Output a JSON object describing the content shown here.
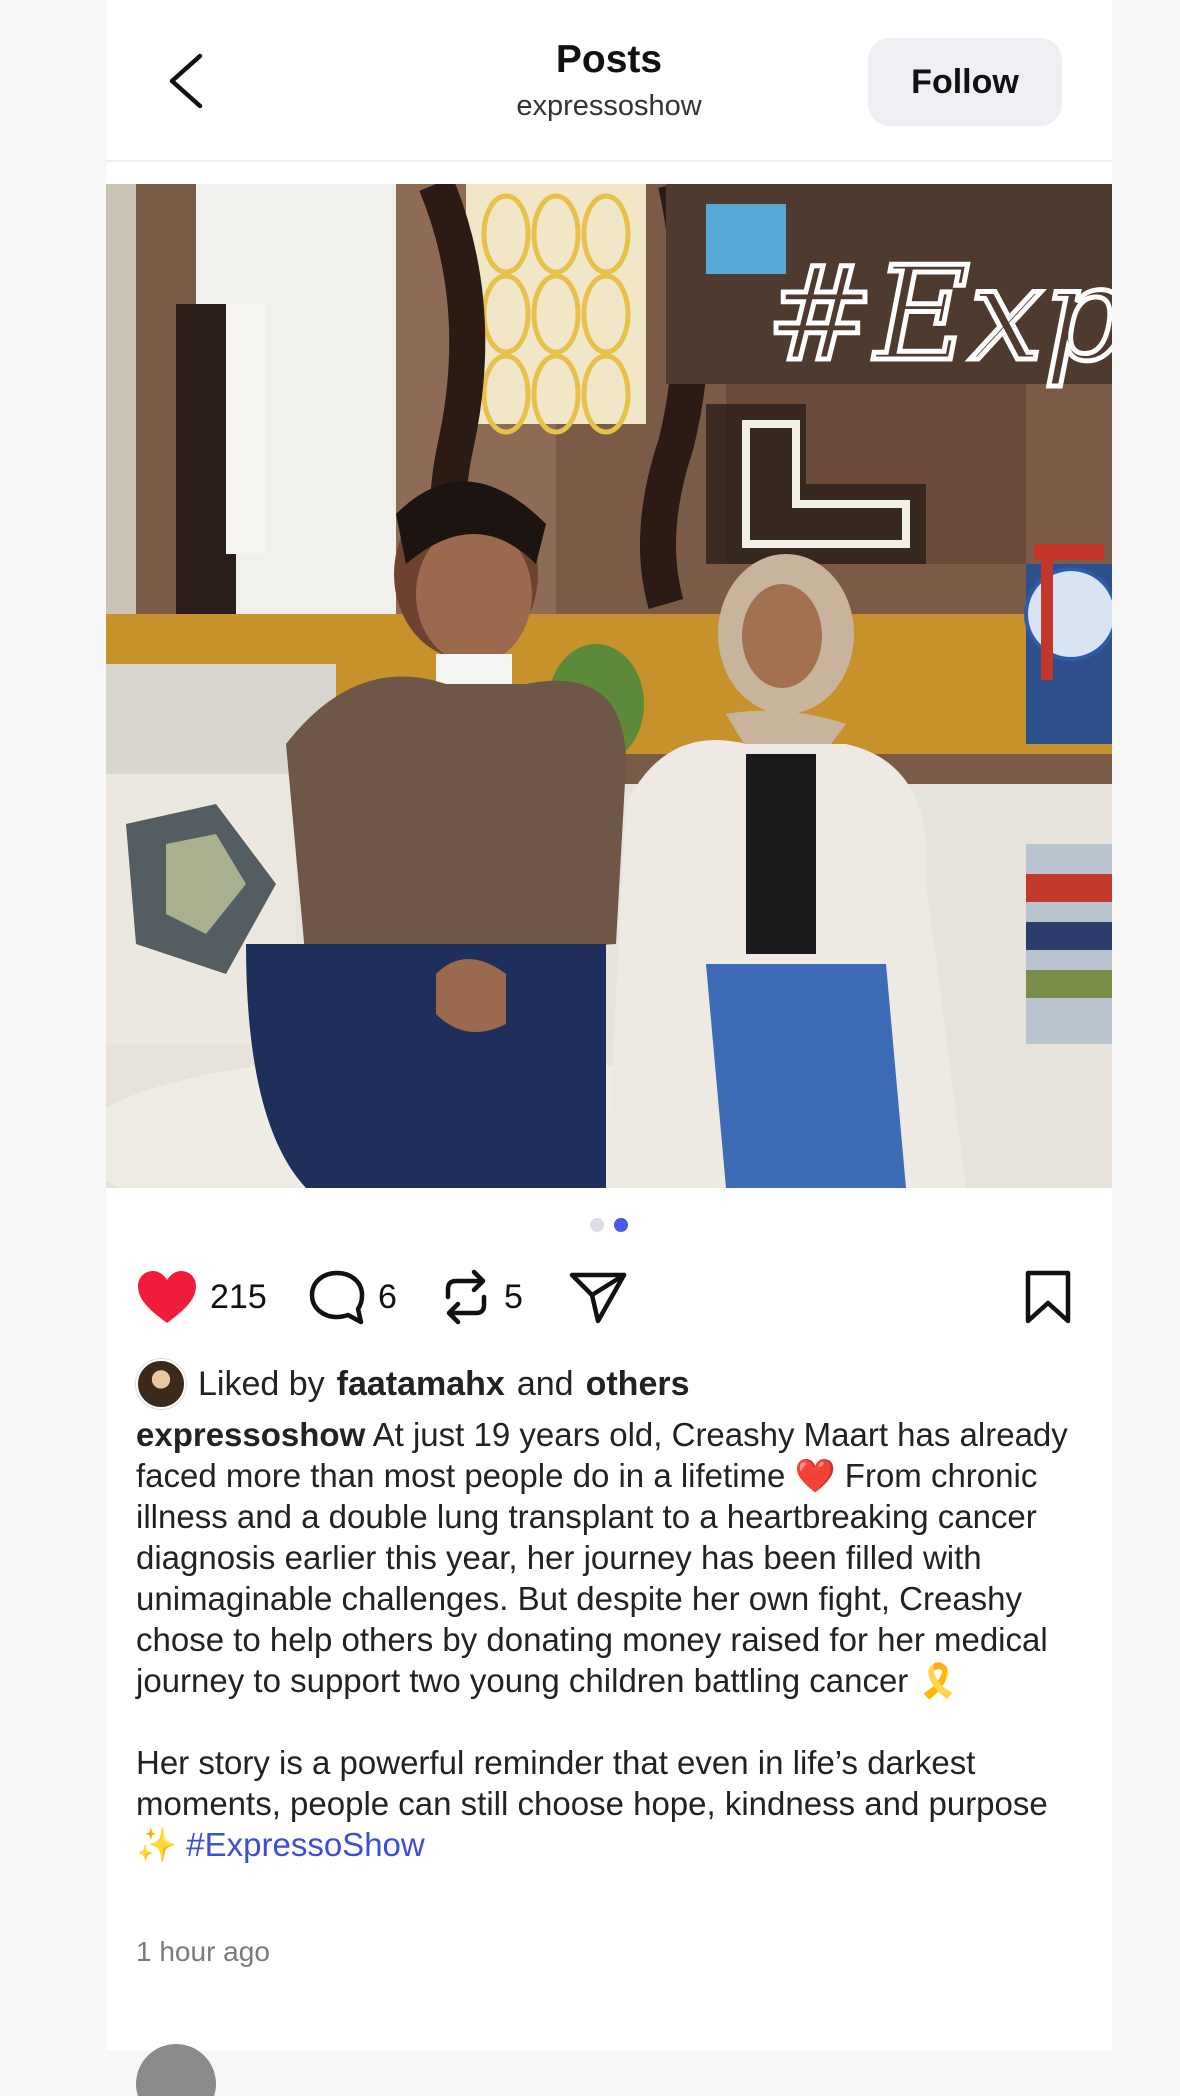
{
  "header": {
    "title": "Posts",
    "username": "expressoshow",
    "follow_label": "Follow"
  },
  "post": {
    "image_neon_text": "#Expr",
    "carousel": {
      "count": 2,
      "active_index": 1
    },
    "actions": {
      "likes": "215",
      "comments": "6",
      "reposts": "5"
    },
    "liked_by": {
      "prefix": "Liked by",
      "user": "faatamahx",
      "joiner": "and",
      "others": "others"
    },
    "caption": {
      "username": "expressoshow",
      "text1": "At just 19 years old, Creashy Maart has already faced more than most people do in a lifetime ❤️ From chronic illness and a double lung transplant to a heartbreaking cancer diagnosis earlier this year, her journey has been filled with unimaginable challenges. But despite her own fight, Creashy chose to help others by donating money raised for her medical journey to support two young children battling cancer 🎗️",
      "text2": "Her story is a powerful reminder that even in life’s darkest moments, people can still choose hope, kindness and purpose ✨",
      "hashtag": "#ExpressoShow"
    },
    "timestamp": "1 hour ago"
  },
  "colors": {
    "like": "#f01d3a",
    "link": "#3c4fd6",
    "active_dot": "#4a5ae8",
    "follow_bg": "#eef0f3"
  },
  "icons": [
    "back-arrow-icon",
    "heart-icon",
    "comment-icon",
    "repost-icon",
    "share-icon",
    "bookmark-icon"
  ]
}
